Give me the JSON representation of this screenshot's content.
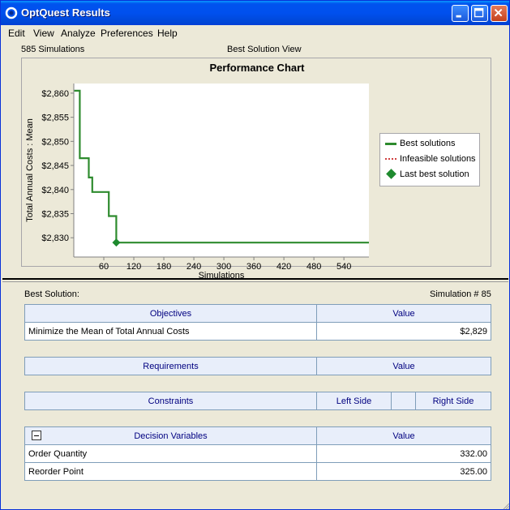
{
  "window": {
    "title": "OptQuest Results",
    "accent_color": "#0053ee"
  },
  "menu": [
    "Edit",
    "View",
    "Analyze",
    "Preferences",
    "Help"
  ],
  "chart_header": {
    "simulations_count": "585 Simulations",
    "view_label": "Best Solution View"
  },
  "chart_data": {
    "type": "line",
    "title": "Performance Chart",
    "xlabel": "Simulations",
    "ylabel": "Total Annual Costs : Mean",
    "xlim": [
      0,
      590
    ],
    "ylim": [
      2826,
      2862
    ],
    "x_ticks": [
      60,
      120,
      180,
      240,
      300,
      360,
      420,
      480,
      540
    ],
    "y_ticks": [
      {
        "value": 2860,
        "label": "$2,860"
      },
      {
        "value": 2855,
        "label": "$2,855"
      },
      {
        "value": 2850,
        "label": "$2,850"
      },
      {
        "value": 2845,
        "label": "$2,845"
      },
      {
        "value": 2840,
        "label": "$2,840"
      },
      {
        "value": 2835,
        "label": "$2,835"
      },
      {
        "value": 2830,
        "label": "$2,830"
      }
    ],
    "series": [
      {
        "name": "Best solutions",
        "color": "#2e8b2e",
        "x": [
          1,
          12,
          12,
          30,
          30,
          37,
          37,
          70,
          70,
          85,
          85,
          590
        ],
        "y": [
          2860.5,
          2860.5,
          2846.5,
          2846.5,
          2842.5,
          2842.5,
          2839.5,
          2839.5,
          2834.5,
          2834.5,
          2829,
          2829
        ]
      },
      {
        "name": "Infeasible solutions",
        "color": "#d04040",
        "x": [],
        "y": []
      }
    ],
    "last_best": {
      "name": "Last best solution",
      "x": 85,
      "y": 2829,
      "color": "#1e8a2e"
    },
    "legend": "right",
    "grid": false
  },
  "best": {
    "label": "Best Solution:",
    "simulation": "Simulation # 85"
  },
  "objectives": {
    "header": "Objectives",
    "value_header": "Value",
    "rows": [
      {
        "name": "Minimize the Mean of Total Annual Costs",
        "value": "$2,829"
      }
    ]
  },
  "requirements": {
    "header": "Requirements",
    "value_header": "Value"
  },
  "constraints": {
    "header": "Constraints",
    "left_header": "Left Side",
    "right_header": "Right Side"
  },
  "decisions": {
    "header": "Decision Variables",
    "value_header": "Value",
    "rows": [
      {
        "name": "Order Quantity",
        "value": "332.00"
      },
      {
        "name": "Reorder Point",
        "value": "325.00"
      }
    ]
  }
}
